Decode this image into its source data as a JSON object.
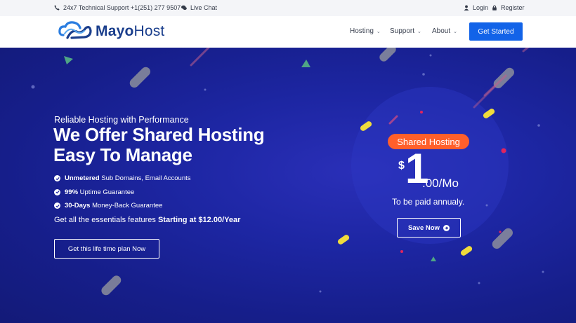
{
  "topbar": {
    "support": "24x7 Technical Support +1(251) 277 9507",
    "chat": "Live Chat",
    "login": "Login",
    "register": "Register"
  },
  "header": {
    "logo_part1": "Mayo",
    "logo_part2": "Host",
    "nav": [
      {
        "label": "Hosting"
      },
      {
        "label": "Support"
      },
      {
        "label": "About"
      }
    ],
    "cta": "Get Started"
  },
  "hero": {
    "tagline": "Reliable Hosting with Performance",
    "title_line1": "We Offer Shared Hosting",
    "title_line2": "Easy To Manage",
    "features": [
      {
        "bold": "Unmetered",
        "text": " Sub Domains, Email Accounts"
      },
      {
        "bold": "99%",
        "text": " Uptime Guarantee"
      },
      {
        "bold": "30-Days",
        "text": " Money-Back Guarantee"
      }
    ],
    "essentials_text": "Get all the essentials features ",
    "essentials_bold": "Starting at $12.00/Year",
    "button": "Get this life time plan Now"
  },
  "pricing": {
    "badge": "Shared Hosting",
    "currency": "$",
    "amount": "1",
    "cents": ".00/Mo",
    "note": "To be paid annualy.",
    "button": "Save Now"
  },
  "colors": {
    "accent": "#1263e8",
    "badge": "#ff5f2b",
    "hero_bg": "#1d26a3",
    "logo": "#1a3e8c"
  }
}
